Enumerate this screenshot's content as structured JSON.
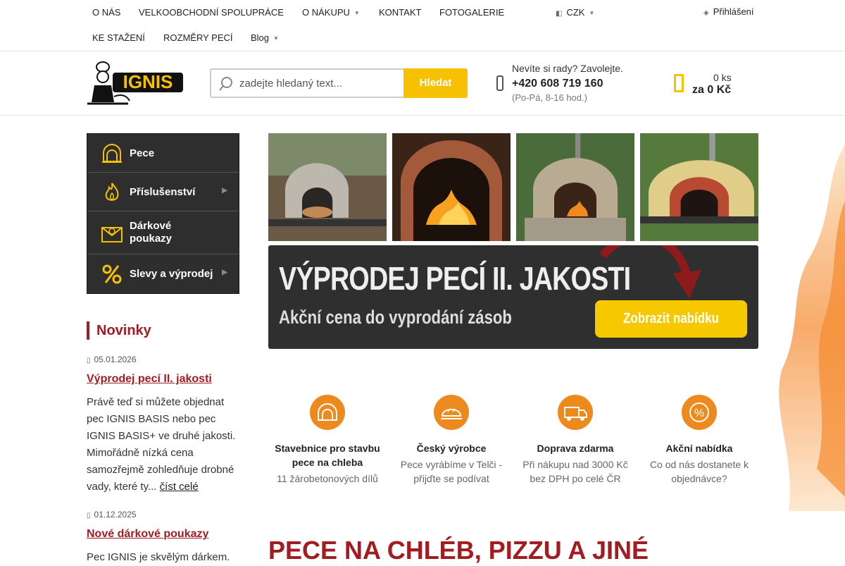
{
  "topnav": {
    "items": [
      "O NÁS",
      "VELKOOBCHODNÍ SPOLUPRÁCE",
      "O NÁKUPU",
      "KONTAKT",
      "FOTOGALERIE",
      "KE STAŽENÍ",
      "ROZMĚRY PECÍ",
      "Blog"
    ],
    "currency": "CZK",
    "login": "Přihlášení"
  },
  "logo": {
    "text": "IGNIS"
  },
  "search": {
    "placeholder": "zadejte hledaný text...",
    "button": "Hledat"
  },
  "contact": {
    "question": "Nevíte si rady? Zavolejte.",
    "phone": "+420 608 719 160",
    "hours": "(Po-Pá, 8-16 hod.)"
  },
  "cart": {
    "qty": "0 ks",
    "total": "za 0 Kč"
  },
  "menu": [
    {
      "label": "Pece",
      "icon": "oven-icon"
    },
    {
      "label": "Příslušenství",
      "icon": "flame-icon"
    },
    {
      "label": "Dárkové poukazy",
      "icon": "gift-voucher-icon"
    },
    {
      "label": "Slevy a výprodej",
      "icon": "percent-icon"
    }
  ],
  "news": {
    "title": "Novinky",
    "items": [
      {
        "date": "05.01.2026",
        "headline": "Výprodej pecí II. jakosti",
        "text": "Právě teď si můžete objednat pec IGNIS BASIS nebo pec IGNIS BASIS+ ve druhé jakosti. Mimořádně nízká cena samozřejmě zohledňuje drobné vady, které ty...",
        "more": "číst celé"
      },
      {
        "date": "01.12.2025",
        "headline": "Nové dárkové poukazy",
        "text": "Pec IGNIS je skvělým dárkem."
      }
    ]
  },
  "banner": {
    "line1": "VÝPRODEJ PECÍ II. JAKOSTI",
    "line2": "Akční cena do vyprodání zásob",
    "cta": "Zobrazit nabídku"
  },
  "features": [
    {
      "title": "Stavebnice pro stavbu pece na chleba",
      "sub": "11 žárobetonových dílů",
      "icon": "oven-icon"
    },
    {
      "title": "Český výrobce",
      "sub": "Pece vyrábíme v Telči - přijďte se podívat",
      "icon": "bread-icon"
    },
    {
      "title": "Doprava zdarma",
      "sub": "Při nákupu nad 3000 Kč bez DPH po celé ČR",
      "icon": "truck-icon"
    },
    {
      "title": "Akční nabídka",
      "sub": "Co od nás dostanete k objednávce?",
      "icon": "percent-badge-icon"
    }
  ],
  "heading": "PECE NA CHLÉB, PIZZU A JINÉ"
}
